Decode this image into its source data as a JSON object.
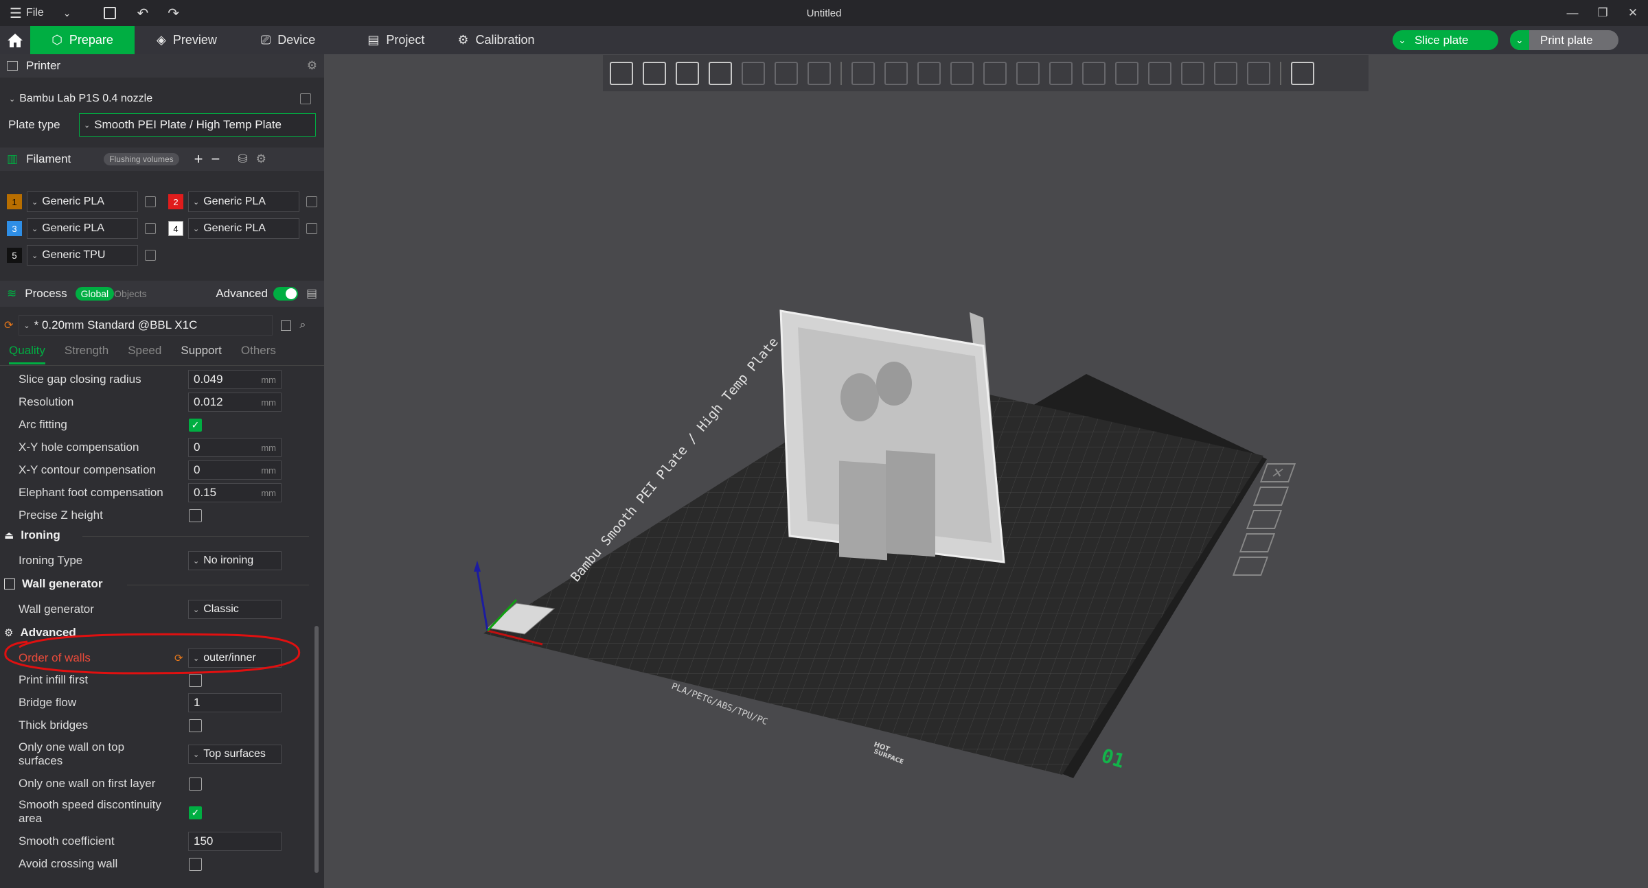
{
  "window": {
    "title": "Untitled",
    "file_label": "File"
  },
  "tabs": {
    "prepare": "Prepare",
    "preview": "Preview",
    "device": "Device",
    "project": "Project",
    "calibration": "Calibration"
  },
  "actions": {
    "slice_plate": "Slice plate",
    "print_plate": "Print plate"
  },
  "printer": {
    "section_title": "Printer",
    "preset": "Bambu Lab P1S 0.4 nozzle",
    "plate_type_label": "Plate type",
    "plate_type_value": "Smooth PEI Plate / High Temp Plate"
  },
  "filament": {
    "section_title": "Filament",
    "flushing_label": "Flushing volumes",
    "slots": [
      {
        "num": "1",
        "name": "Generic PLA",
        "color": "#b86e00"
      },
      {
        "num": "2",
        "name": "Generic PLA",
        "color": "#e01c1c"
      },
      {
        "num": "3",
        "name": "Generic PLA",
        "color": "#2e8ee6"
      },
      {
        "num": "4",
        "name": "Generic PLA",
        "color": "#ffffff"
      },
      {
        "num": "5",
        "name": "Generic TPU",
        "color": "#111111"
      }
    ]
  },
  "process": {
    "section_title": "Process",
    "global_label": "Global",
    "objects_label": "Objects",
    "advanced_label": "Advanced",
    "advanced_on": true,
    "preset": "* 0.20mm Standard @BBL X1C",
    "tabs": [
      "Quality",
      "Strength",
      "Speed",
      "Support",
      "Others"
    ],
    "active_tab": "Quality"
  },
  "settings": {
    "slice_gap": {
      "label": "Slice gap closing radius",
      "value": "0.049",
      "unit": "mm"
    },
    "resolution": {
      "label": "Resolution",
      "value": "0.012",
      "unit": "mm"
    },
    "arc_fitting": {
      "label": "Arc fitting",
      "checked": true
    },
    "xy_hole": {
      "label": "X-Y hole compensation",
      "value": "0",
      "unit": "mm"
    },
    "xy_contour": {
      "label": "X-Y contour compensation",
      "value": "0",
      "unit": "mm"
    },
    "elephant_foot": {
      "label": "Elephant foot compensation",
      "value": "0.15",
      "unit": "mm"
    },
    "precise_z": {
      "label": "Precise Z height",
      "checked": false
    },
    "ironing_group": "Ironing",
    "ironing_type": {
      "label": "Ironing Type",
      "value": "No ironing"
    },
    "wall_gen_group": "Wall generator",
    "wall_generator": {
      "label": "Wall generator",
      "value": "Classic"
    },
    "advanced_group": "Advanced",
    "order_of_walls": {
      "label": "Order of walls",
      "value": "outer/inner"
    },
    "print_infill_first": {
      "label": "Print infill first",
      "checked": false
    },
    "bridge_flow": {
      "label": "Bridge flow",
      "value": "1"
    },
    "thick_bridges": {
      "label": "Thick bridges",
      "checked": false
    },
    "one_wall_top": {
      "label_1": "Only one wall on top",
      "label_2": "surfaces",
      "value": "Top surfaces"
    },
    "one_wall_first": {
      "label": "Only one wall on first layer",
      "checked": false
    },
    "smooth_speed": {
      "label_1": "Smooth speed discontinuity",
      "label_2": "area",
      "checked": true
    },
    "smooth_coeff": {
      "label": "Smooth coefficient",
      "value": "150"
    },
    "avoid_crossing": {
      "label": "Avoid crossing wall",
      "checked": false
    }
  },
  "plate": {
    "side_text": "Bambu Smooth PEI Plate / High Temp Plate",
    "front_text": "PLA/PETG/ABS/TPU/PC",
    "hot_text_1": "HOT",
    "hot_text_2": "SURFACE",
    "plate_number": "01"
  },
  "colors": {
    "accent": "#00ae42",
    "highlight": "#e84a3a",
    "annotation": "#e01010"
  }
}
